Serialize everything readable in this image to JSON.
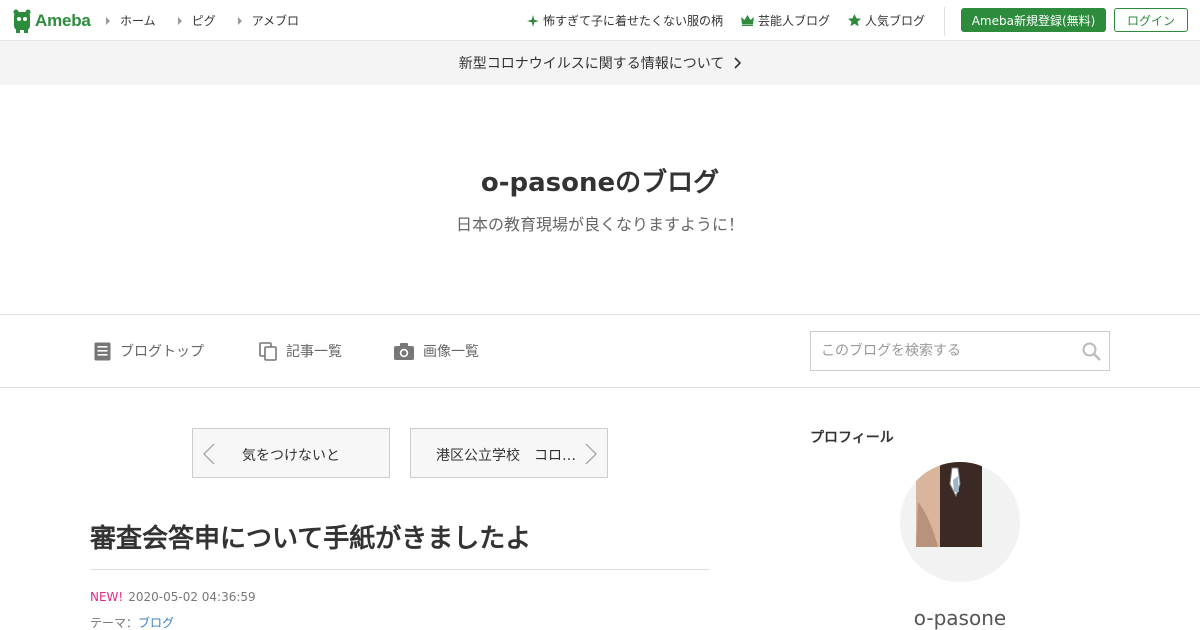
{
  "header": {
    "logo_text": "Ameba",
    "nav": [
      {
        "label": "ホーム"
      },
      {
        "label": "ピグ"
      },
      {
        "label": "アメブロ"
      }
    ],
    "promos": [
      {
        "label": "怖すぎて子に着せたくない服の柄",
        "icon": "sparkle-icon"
      },
      {
        "label": "芸能人ブログ",
        "icon": "crown-icon"
      },
      {
        "label": "人気ブログ",
        "icon": "star-icon"
      }
    ],
    "register_label": "Ameba新規登録(無料)",
    "login_label": "ログイン",
    "brand_color": "#2d8c3c"
  },
  "notice": {
    "text": "新型コロナウイルスに関する情報について"
  },
  "blog": {
    "title": "o-pasoneのブログ",
    "description": "日本の教育現場が良くなりますように！"
  },
  "blog_nav": {
    "items": [
      {
        "label": "ブログトップ",
        "icon": "document-icon"
      },
      {
        "label": "記事一覧",
        "icon": "copy-icon"
      },
      {
        "label": "画像一覧",
        "icon": "camera-icon"
      }
    ],
    "search_placeholder": "このブログを検索する"
  },
  "pager": {
    "prev_label": "気をつけないと",
    "next_label": "港区公立学校　コロナウイルス"
  },
  "article": {
    "title": "審査会答申について手紙がきましたよ",
    "new_badge": "NEW!",
    "datetime": "2020-05-02 04:36:59",
    "theme_prefix": "テーマ：",
    "theme_link": "ブログ"
  },
  "sidebar": {
    "profile_heading": "プロフィール",
    "profile_name": "o-pasone"
  }
}
